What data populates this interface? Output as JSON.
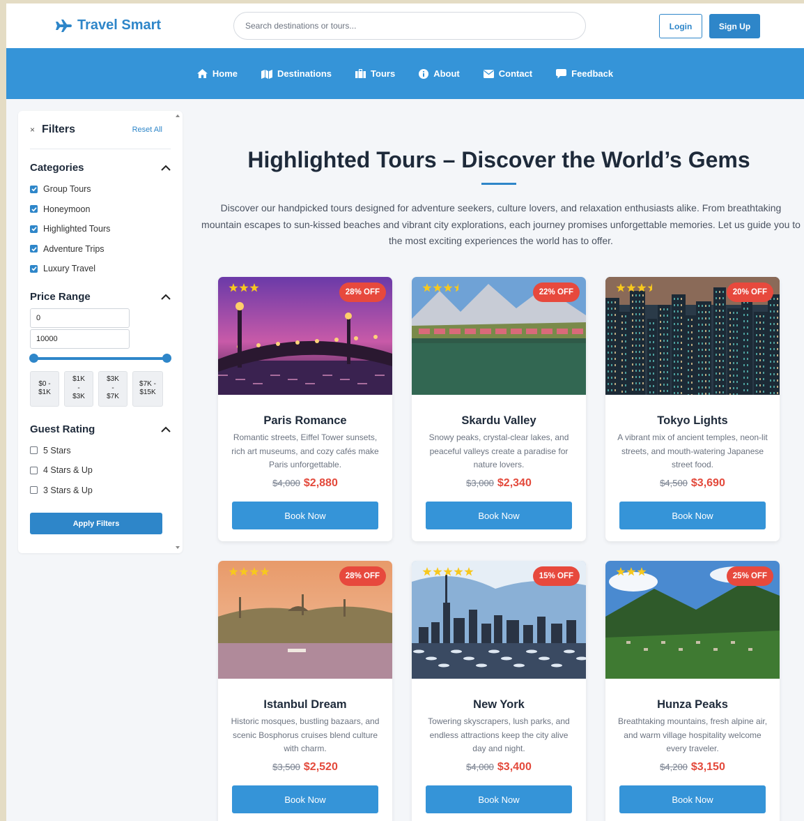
{
  "header": {
    "logo_text": "Travel Smart",
    "search_placeholder": "Search destinations or tours...",
    "login_label": "Login",
    "signup_label": "Sign Up"
  },
  "nav": {
    "items": [
      {
        "label": "Home",
        "icon": "home-icon"
      },
      {
        "label": "Destinations",
        "icon": "map-icon"
      },
      {
        "label": "Tours",
        "icon": "suitcase-icon"
      },
      {
        "label": "About",
        "icon": "info-icon"
      },
      {
        "label": "Contact",
        "icon": "envelope-icon"
      },
      {
        "label": "Feedback",
        "icon": "comment-icon"
      }
    ]
  },
  "sidebar": {
    "close_glyph": "×",
    "title": "Filters",
    "reset_label": "Reset All",
    "categories": {
      "title": "Categories",
      "items": [
        {
          "label": "Group Tours",
          "checked": true
        },
        {
          "label": "Honeymoon",
          "checked": true
        },
        {
          "label": "Highlighted Tours",
          "checked": true
        },
        {
          "label": "Adventure Trips",
          "checked": true
        },
        {
          "label": "Luxury Travel",
          "checked": true
        }
      ]
    },
    "price_range": {
      "title": "Price Range",
      "min_value": "0",
      "max_value": "10000",
      "slider_min_fraction": 0,
      "slider_max_fraction": 1,
      "presets": [
        "$0 -\n$1K",
        "$1K\n-\n$3K",
        "$3K\n-\n$7K",
        "$7K -\n$15K"
      ]
    },
    "guest_rating": {
      "title": "Guest Rating",
      "items": [
        {
          "label": "5 Stars",
          "checked": false
        },
        {
          "label": "4 Stars & Up",
          "checked": false
        },
        {
          "label": "3 Stars & Up",
          "checked": false
        }
      ]
    },
    "apply_label": "Apply Filters"
  },
  "main": {
    "title": "Highlighted Tours – Discover the World’s Gems",
    "intro": "Discover our handpicked tours designed for adventure seekers, culture lovers, and relaxation enthusiasts alike. From breathtaking mountain escapes to sun-kissed beaches and vibrant city explorations, each journey promises unforgettable memories. Let us guide you to the most exciting experiences the world has to offer.",
    "book_label": "Book Now",
    "tours": [
      {
        "title": "Paris Romance",
        "desc": "Romantic streets, Eiffel Tower sunsets, rich art museums, and cozy cafés make Paris unforgettable.",
        "old_price": "$4,000",
        "new_price": "$2,880",
        "discount": "28% OFF",
        "rating": 3,
        "scene": "paris"
      },
      {
        "title": "Skardu Valley",
        "desc": "Snowy peaks, crystal-clear lakes, and peaceful valleys create a paradise for nature lovers.",
        "old_price": "$3,000",
        "new_price": "$2,340",
        "discount": "22% OFF",
        "rating": 3.5,
        "scene": "skardu"
      },
      {
        "title": "Tokyo Lights",
        "desc": "A vibrant mix of ancient temples, neon-lit streets, and mouth-watering Japanese street food.",
        "old_price": "$4,500",
        "new_price": "$3,690",
        "discount": "20% OFF",
        "rating": 3.5,
        "scene": "tokyo"
      },
      {
        "title": "Istanbul Dream",
        "desc": "Historic mosques, bustling bazaars, and scenic Bosphorus cruises blend culture with charm.",
        "old_price": "$3,500",
        "new_price": "$2,520",
        "discount": "28% OFF",
        "rating": 4,
        "scene": "istanbul"
      },
      {
        "title": "New York",
        "desc": "Towering skyscrapers, lush parks, and endless attractions keep the city alive day and night.",
        "old_price": "$4,000",
        "new_price": "$3,400",
        "discount": "15% OFF",
        "rating": 5,
        "scene": "newyork"
      },
      {
        "title": "Hunza Peaks",
        "desc": "Breathtaking mountains, fresh alpine air, and warm village hospitality welcome every traveler.",
        "old_price": "$4,200",
        "new_price": "$3,150",
        "discount": "25% OFF",
        "rating": 3,
        "scene": "hunza"
      }
    ]
  },
  "colors": {
    "accent": "#2e86c9",
    "nav_bg": "#3594d8",
    "badge": "#e7493d",
    "price": "#e3493b",
    "star": "#f7c81e"
  }
}
